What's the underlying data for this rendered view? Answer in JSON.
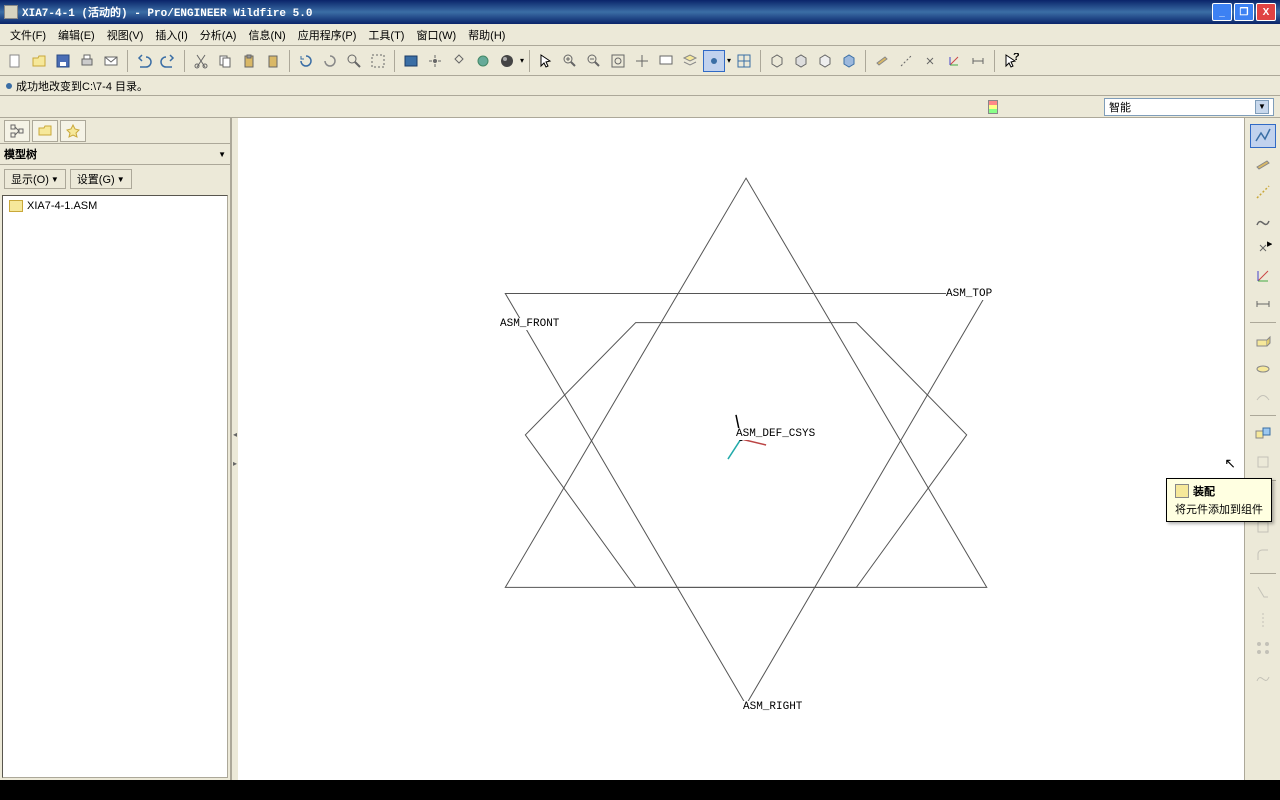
{
  "title": "XIA7-4-1 (活动的) - Pro/ENGINEER Wildfire 5.0",
  "menu": {
    "file": "文件(F)",
    "edit": "编辑(E)",
    "view": "视图(V)",
    "insert": "插入(I)",
    "analysis": "分析(A)",
    "info": "信息(N)",
    "app": "应用程序(P)",
    "tools": "工具(T)",
    "window": "窗口(W)",
    "help": "帮助(H)"
  },
  "status": "成功地改变到C:\\7-4 目录。",
  "selector": "智能",
  "tree": {
    "header": "模型树",
    "show_btn": "显示(O)",
    "settings_btn": "设置(G)",
    "root": "XIA7-4-1.ASM"
  },
  "canvas_labels": {
    "top": "ASM_TOP",
    "front": "ASM_FRONT",
    "right": "ASM_RIGHT",
    "csys": "ASM_DEF_CSYS"
  },
  "tooltip": {
    "title": "装配",
    "body": "将元件添加到组件"
  }
}
